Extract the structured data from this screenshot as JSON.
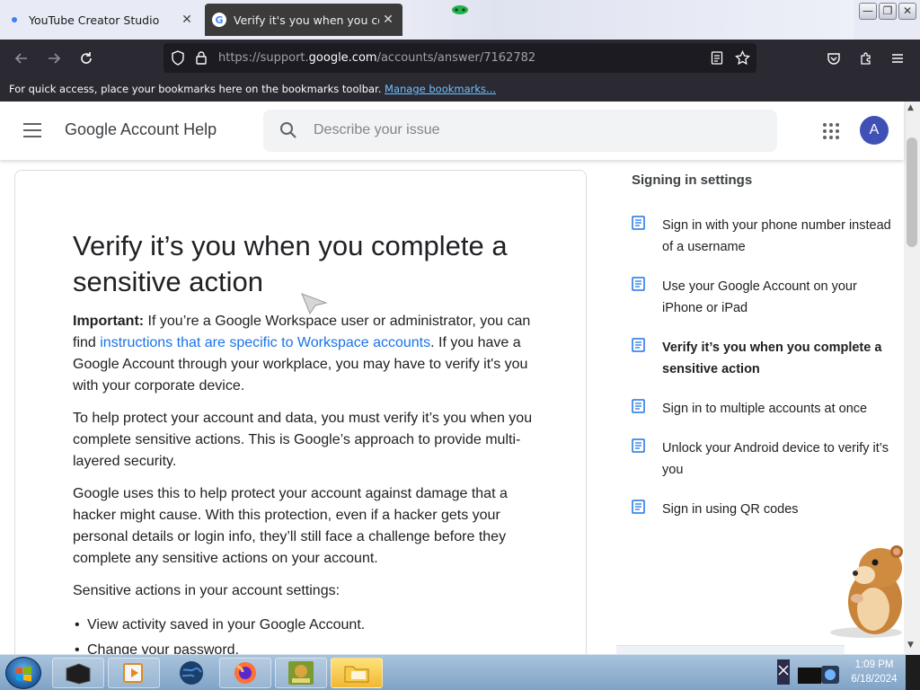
{
  "browser": {
    "tabs": [
      {
        "title": "YouTube Creator Studio",
        "active": false
      },
      {
        "title": "Verify it's you when you complete",
        "active": true
      }
    ],
    "window_controls": {
      "minimize": "—",
      "restore": "❐",
      "close": "✕"
    },
    "url": {
      "prefix": "https://support.",
      "domain": "google.com",
      "path": "/accounts/answer/7162782"
    },
    "bookmarks_bar": {
      "message": "For quick access, place your bookmarks here on the bookmarks toolbar.",
      "link": "Manage bookmarks..."
    }
  },
  "header": {
    "title": "Google Account Help",
    "search_placeholder": "Describe your issue",
    "avatar_letter": "A"
  },
  "article": {
    "title": "Verify it’s you when you complete a sensitive action",
    "important_label": "Important:",
    "important_text_1": " If you’re a Google Workspace user or administrator, you can find ",
    "important_link": "instructions that are specific to Workspace accounts",
    "important_text_2": ". If you have a Google Account through your workplace, you may have to verify it's you with your corporate device.",
    "paragraph_2": "To help protect your account and data, you must verify it’s you when you complete sensitive actions. This is Google’s approach to provide multi-layered security.",
    "paragraph_3": "Google uses this to help protect your account against damage that a hacker might cause. With this protection, even if a hacker gets your personal details or login info, they’ll still face a challenge before they complete any sensitive actions on your account.",
    "paragraph_4": "Sensitive actions in your account settings:",
    "bullets": [
      "View activity saved in your Google Account.",
      "Change your password."
    ]
  },
  "sidebar": {
    "heading": "Signing in settings",
    "items": [
      {
        "label": "Sign in with your phone number instead of a username",
        "current": false
      },
      {
        "label": "Use your Google Account on your iPhone or iPad",
        "current": false
      },
      {
        "label": "Verify it’s you when you complete a sensitive action",
        "current": true
      },
      {
        "label": "Sign in to multiple accounts at once",
        "current": false
      },
      {
        "label": "Unlock your Android device to verify it’s you",
        "current": false
      },
      {
        "label": "Sign in using QR codes",
        "current": false
      }
    ]
  },
  "taskbar": {
    "time": "1:09 PM",
    "date": "6/18/2024"
  },
  "colors": {
    "link": "#1a73e8",
    "avatar": "#3f51b5",
    "firefox_chrome": "#2b2a33"
  }
}
